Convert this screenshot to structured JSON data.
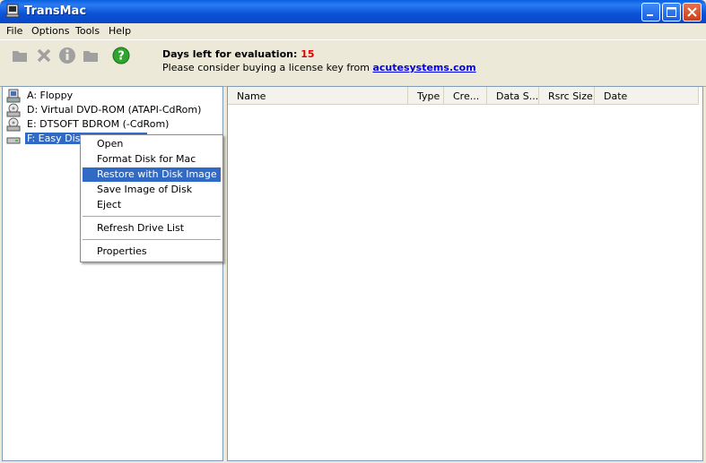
{
  "window": {
    "title": "TransMac"
  },
  "menubar": {
    "items": [
      "File",
      "Options",
      "Tools",
      "Help"
    ]
  },
  "toolbar": {
    "notice_label": "Days left for evaluation:",
    "days_left": "15",
    "license_text": "Please consider buying a license key from",
    "license_link": "acutesystems.com"
  },
  "drives": [
    {
      "label": "A: Floppy",
      "icon": "floppy-drive-icon"
    },
    {
      "label": "D: Virtual DVD-ROM (ATAPI-CdRom)",
      "icon": "cd-drive-icon"
    },
    {
      "label": "E: DTSOFT BDROM (-CdRom)",
      "icon": "cd-drive-icon"
    },
    {
      "label": "F: Easy Disk USB2 Drive",
      "icon": "usb-drive-icon",
      "selected": true
    }
  ],
  "file_list": {
    "columns": [
      "Name",
      "Type",
      "Cre...",
      "Data S...",
      "Rsrc Size",
      "Date"
    ]
  },
  "context_menu": {
    "items": [
      "Open",
      "Format Disk for Mac",
      "Restore with Disk Image",
      "Save Image of Disk",
      "Eject",
      "Refresh Drive List",
      "Properties"
    ],
    "highlighted": "Restore with Disk Image"
  },
  "colors": {
    "selection": "#316ac5",
    "titlebar": "#0b52d6",
    "days_left": "#e00000",
    "link": "#0000e0"
  }
}
